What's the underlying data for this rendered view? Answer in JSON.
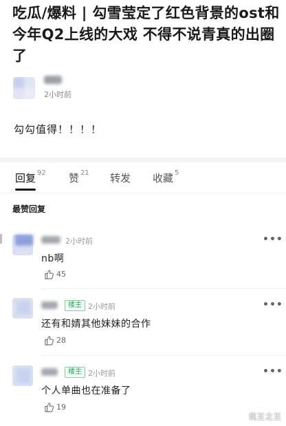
{
  "post": {
    "title": "吃瓜/爆料 | 勾雪莹定了红色背景的ost和今年Q2上线的大戏 不得不说青真的出圈了",
    "author_time": "2小时前",
    "body": "勾勾值得！！！！"
  },
  "tabs": [
    {
      "label": "回复",
      "count": "92",
      "active": true
    },
    {
      "label": "赞",
      "count": "21",
      "active": false
    },
    {
      "label": "转发",
      "count": "",
      "active": false
    },
    {
      "label": "收藏",
      "count": "5",
      "active": false
    }
  ],
  "section_label": "最赞回复",
  "comments": [
    {
      "time": "2小时前",
      "badge": "",
      "text": "nb啊",
      "likes": "45",
      "more": "•••"
    },
    {
      "time": "2小时前",
      "badge": "楼主",
      "text": "还有和婧其他妹妹的合作",
      "likes": "28",
      "more": "•••"
    },
    {
      "time": "2小时前",
      "badge": "楼主",
      "text": "个人单曲也在准备了",
      "likes": "19",
      "more": "•••"
    }
  ],
  "watermark": "侃王之王",
  "icons": [
    "thumb-up-icon",
    "more-icon"
  ],
  "colors": {
    "badge_green": "#25a35a",
    "avatar_blue": "#dbe1f2"
  }
}
